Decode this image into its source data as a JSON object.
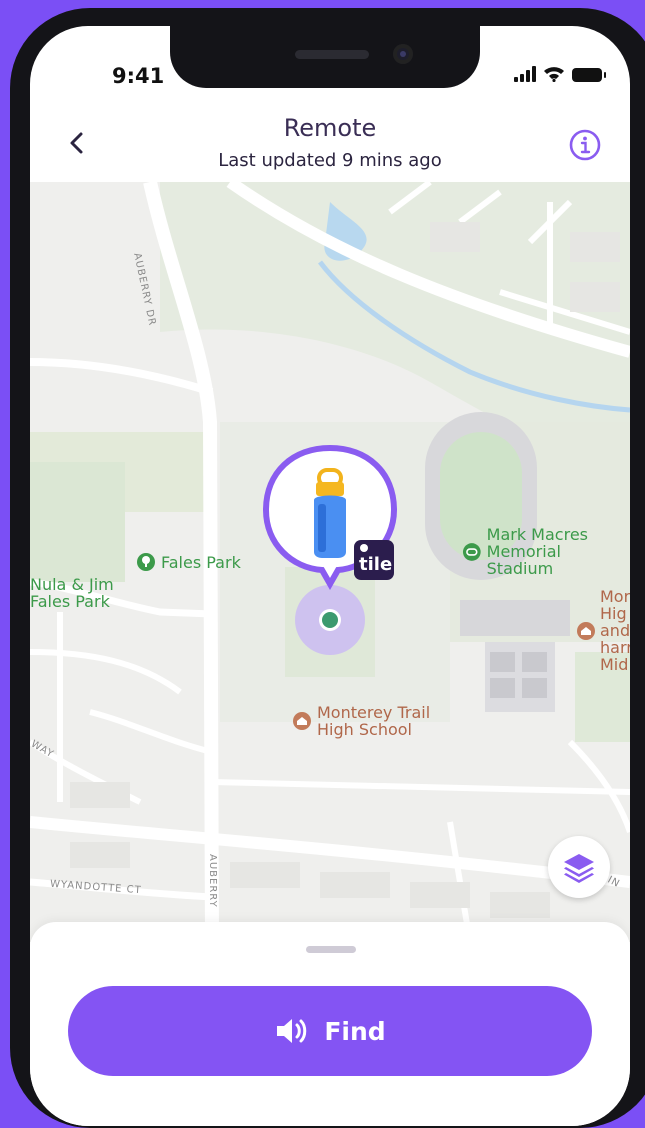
{
  "status_bar": {
    "time": "9:41"
  },
  "header": {
    "title": "Remote",
    "subtitle": "Last updated 9 mins ago"
  },
  "map": {
    "places": {
      "fales_park": "Fales Park",
      "nula_jim_line1": "Nula & Jim",
      "nula_jim_line2": "Fales Park",
      "stadium_line1": "Mark Macres",
      "stadium_line2": "Memorial Stadium",
      "school_line1": "Monterey Trail",
      "school_line2": "High School",
      "middle_line1": "Mor",
      "middle_line2": "Hig",
      "middle_line3": "and",
      "middle_line4": "harr",
      "middle_line5": "Mid"
    },
    "streets": {
      "auberry_top": "AUBERRY DR",
      "auberry_bottom": "AUBERRY",
      "wyandotte": "WYANDOTTE CT",
      "way": "WAY",
      "right_edge": "R IN"
    },
    "device_brand": "tile"
  },
  "bottom_sheet": {
    "find_label": "Find"
  },
  "colors": {
    "accent": "#8454f3",
    "background": "#7b4ff5",
    "pin_ring": "#8a5cf0",
    "park_text": "#3c9a4a",
    "poi_text": "#b0674a"
  },
  "icons": {
    "back": "chevron-left-icon",
    "info": "info-icon",
    "layers": "layers-icon",
    "sound": "speaker-icon",
    "device": "water-bottle-icon"
  }
}
